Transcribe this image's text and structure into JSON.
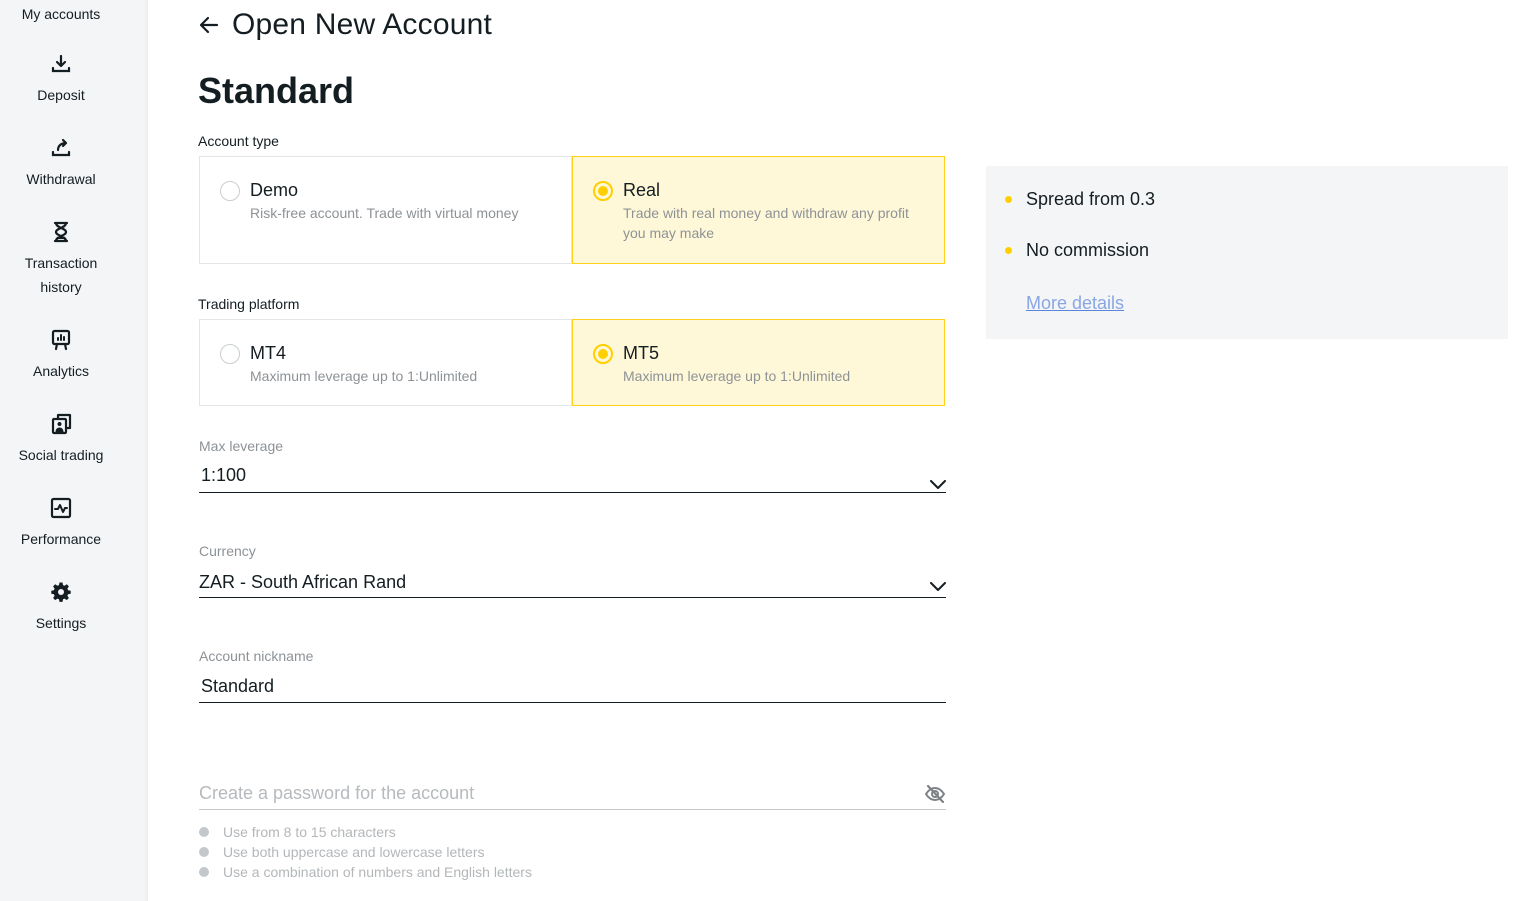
{
  "sidebar": {
    "items": [
      {
        "label": "My accounts",
        "icon": "wallet-icon"
      },
      {
        "label": "Deposit",
        "icon": "download-icon"
      },
      {
        "label": "Withdrawal",
        "icon": "upload-share-icon"
      },
      {
        "label": "Transaction history",
        "label_line1": "Transaction",
        "label_line2": "history",
        "icon": "hourglass-icon"
      },
      {
        "label": "Analytics",
        "icon": "presentation-chart-icon"
      },
      {
        "label": "Social trading",
        "icon": "copy-portrait-icon"
      },
      {
        "label": "Performance",
        "icon": "activity-chart-icon"
      },
      {
        "label": "Settings",
        "icon": "gear-icon"
      }
    ]
  },
  "header": {
    "back_icon": "arrow-left-icon",
    "title": "Open New Account"
  },
  "section_title": "Standard",
  "account_type": {
    "label": "Account type",
    "selected": "Real",
    "options": [
      {
        "title": "Demo",
        "description": "Risk-free account. Trade with virtual money",
        "selected": false
      },
      {
        "title": "Real",
        "description": "Trade with real money and withdraw any profit you may make",
        "selected": true
      }
    ]
  },
  "trading_platform": {
    "label": "Trading platform",
    "selected": "MT5",
    "options": [
      {
        "title": "MT4",
        "description": "Maximum leverage up to 1:Unlimited",
        "selected": false
      },
      {
        "title": "MT5",
        "description": "Maximum leverage up to 1:Unlimited",
        "selected": true
      }
    ]
  },
  "max_leverage": {
    "label": "Max leverage",
    "value": "1:100"
  },
  "currency": {
    "label": "Currency",
    "value": "ZAR - South African Rand"
  },
  "nickname": {
    "label": "Account nickname",
    "value": "Standard"
  },
  "password": {
    "placeholder": "Create a password for the account",
    "toggle_icon": "eye-off-icon",
    "rules": [
      "Use from 8 to 15 characters",
      "Use both uppercase and lowercase letters",
      "Use a combination of numbers and English letters"
    ]
  },
  "info_panel": {
    "items": [
      "Spread from 0.3",
      "No commission"
    ],
    "link": "More details"
  },
  "colors": {
    "accent": "#ffcf00",
    "selected_bg": "#fff8d8",
    "sidebar_bg": "#f3f5f7",
    "link": "#8aa6e2",
    "text": "#141d22",
    "muted": "#8d9296"
  }
}
